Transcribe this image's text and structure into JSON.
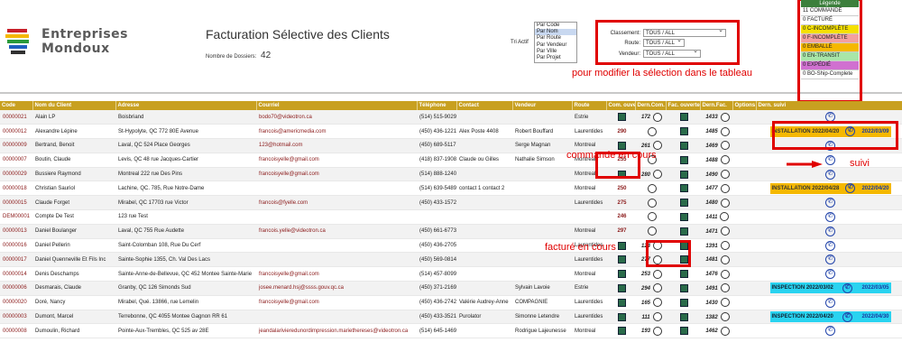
{
  "header": {
    "logo_line1": "Entreprises",
    "logo_line2": "Mondoux",
    "title": "Facturation Sélective des Clients",
    "dossier_label": "Nombre de Dossiers:",
    "dossier_count": "42",
    "tri_label": "Tri Actif",
    "tri_options": [
      "Par Code",
      "Par Nom",
      "Par Route",
      "Par Vendeur",
      "Par Ville",
      "Par Projet"
    ],
    "tri_selected_index": 1
  },
  "filters": {
    "classement_label": "Classement:",
    "classement_value": "TOUS / ALL",
    "route_label": "Route:",
    "route_value": "TOUS / ALL",
    "vendeur_label": "Vendeur:",
    "vendeur_value": "TOUS / ALL"
  },
  "annotations": {
    "modify": "pour modifier la sélection dans le tableau",
    "commande": "commande en cours",
    "facture": "facturé en cours",
    "suivi": "suivi"
  },
  "legend": {
    "title": "Légende",
    "items": [
      {
        "label": "11 COMMANDÉ",
        "color": "#ffffff"
      },
      {
        "label": "0 FACTURÉ",
        "color": "#ffffff"
      },
      {
        "label": "0 C-INCOMPLÈTE",
        "color": "#f5e000"
      },
      {
        "label": "0 F-INCOMPLÈTE",
        "color": "#f3a0a0"
      },
      {
        "label": "0 EMBALLÉ",
        "color": "#f5b800"
      },
      {
        "label": "0 EN-TRANSIT",
        "color": "#a8e6a8"
      },
      {
        "label": "0 EXPÉDIÉ",
        "color": "#d070d0"
      },
      {
        "label": "0 BO-Ship-Complete",
        "color": "#ffffff"
      }
    ]
  },
  "table": {
    "headers": [
      "Code",
      "Nom du Client",
      "Adresse",
      "Courriel",
      "Téléphone",
      "Contact",
      "Vendeur",
      "Route",
      "Com. ouverte",
      "Dern.Com.",
      "Fac. ouverte",
      "Dern.Fac.",
      "Options",
      "Dern. suivi"
    ],
    "rows": [
      {
        "code": "00000021",
        "nom": "Alain LP",
        "adresse": "Boisbriand",
        "courriel": "bodo70@videotron.ca",
        "tel": "(514) 515-9029",
        "contact": "",
        "vendeur": "",
        "route": "Estrie",
        "com_open": "",
        "dern_com": "172",
        "fac_open": "",
        "dern_fac": "1433",
        "suivi_type": "",
        "suivi_text": "",
        "suivi_date": ""
      },
      {
        "code": "00000012",
        "nom": "Alexandre Lépine",
        "adresse": "St-Hypolyte, QC 772 80E Avenue",
        "courriel": "francois@americmedia.com",
        "tel": "(450) 436-1221",
        "contact": "Alex Poste 4408",
        "vendeur": "Robert Bouffard",
        "route": "Laurentides",
        "com_open": "290",
        "dern_com": "",
        "fac_open": "",
        "dern_fac": "1485",
        "suivi_type": "install",
        "suivi_text": "INSTALLATION 2022/04/20",
        "suivi_date": "2022/03/09"
      },
      {
        "code": "00000009",
        "nom": "Bertrand, Benoit",
        "adresse": "Laval, QC 524 Place Georges",
        "courriel": "123@hotmail.com",
        "tel": "(450) 689-5117",
        "contact": "",
        "vendeur": "Serge Magnan",
        "route": "Montreal",
        "com_open": "",
        "dern_com": "261",
        "fac_open": "",
        "dern_fac": "1469",
        "suivi_type": "",
        "suivi_text": "",
        "suivi_date": ""
      },
      {
        "code": "00000007",
        "nom": "Boutin, Claude",
        "adresse": "Levis, QC 48 rue Jacques-Cartier",
        "courriel": "francoisyelle@gmail.com",
        "tel": "(418) 837-1908",
        "contact": "Claude ou Gilles",
        "vendeur": "Nathalie Simson",
        "route": "Montreal",
        "com_open": "255",
        "dern_com": "",
        "fac_open": "",
        "dern_fac": "1488",
        "suivi_type": "",
        "suivi_text": "",
        "suivi_date": ""
      },
      {
        "code": "00000029",
        "nom": "Bussiere Raymond",
        "adresse": "Montreal 222 rue Des Pins",
        "courriel": "francoisyelle@gmail.com",
        "tel": "(514) 888-1240",
        "contact": "",
        "vendeur": "",
        "route": "Montreal",
        "com_open": "",
        "dern_com": "280",
        "fac_open": "",
        "dern_fac": "1490",
        "suivi_type": "",
        "suivi_text": "",
        "suivi_date": ""
      },
      {
        "code": "00000018",
        "nom": "Christian Sauriol",
        "adresse": "Lachine, QC. 785, Rue Notre-Dame",
        "courriel": "",
        "tel": "(514) 639-5489",
        "contact": "contact 1 contact 2",
        "vendeur": "",
        "route": "Montreal",
        "com_open": "250",
        "dern_com": "",
        "fac_open": "",
        "dern_fac": "1477",
        "suivi_type": "install",
        "suivi_text": "INSTALLATION 2022/04/28",
        "suivi_date": "2022/04/20"
      },
      {
        "code": "00000015",
        "nom": "Claude Forget",
        "adresse": "Mirabel, QC 17703 rue Victor",
        "courriel": "francois@fyelle.com",
        "tel": "(450) 433-1572",
        "contact": "",
        "vendeur": "",
        "route": "Laurentides",
        "com_open": "275",
        "dern_com": "",
        "fac_open": "",
        "dern_fac": "1480",
        "suivi_type": "",
        "suivi_text": "",
        "suivi_date": ""
      },
      {
        "code": "DEM00001",
        "nom": "Compte De Test",
        "adresse": "123 rue Test",
        "courriel": "",
        "tel": "",
        "contact": "",
        "vendeur": "",
        "route": "",
        "com_open": "246",
        "dern_com": "",
        "fac_open": "",
        "dern_fac": "1411",
        "suivi_type": "",
        "suivi_text": "",
        "suivi_date": ""
      },
      {
        "code": "00000013",
        "nom": "Daniel Boulanger",
        "adresse": "Laval, QC 755 Rue Audette",
        "courriel": "francois.yelle@videotron.ca",
        "tel": "(450) 661-6773",
        "contact": "",
        "vendeur": "",
        "route": "Montreal",
        "com_open": "297",
        "dern_com": "",
        "fac_open": "",
        "dern_fac": "1471",
        "suivi_type": "",
        "suivi_text": "",
        "suivi_date": ""
      },
      {
        "code": "00000016",
        "nom": "Daniel Pellerin",
        "adresse": "Saint-Colomban 108, Rue Du Cerf",
        "courriel": "",
        "tel": "(450) 436-2705",
        "contact": "",
        "vendeur": "",
        "route": "Laurentides",
        "com_open": "",
        "dern_com": "124",
        "fac_open": "",
        "dern_fac": "1391",
        "suivi_type": "",
        "suivi_text": "",
        "suivi_date": ""
      },
      {
        "code": "00000017",
        "nom": "Daniel Quenneville Et Fils Inc",
        "adresse": "Sainte-Sophie 1355, Ch. Val Des Lacs",
        "courriel": "",
        "tel": "(450) 569-0814",
        "contact": "",
        "vendeur": "",
        "route": "Laurentides",
        "com_open": "",
        "dern_com": "277",
        "fac_open": "",
        "dern_fac": "1481",
        "suivi_type": "",
        "suivi_text": "",
        "suivi_date": ""
      },
      {
        "code": "00000014",
        "nom": "Denis Deschamps",
        "adresse": "Sainte-Anne-de-Bellevue, QC 452 Montee Sainte-Marie",
        "courriel": "francoisyelle@gmail.com",
        "tel": "(514) 457-8099",
        "contact": "",
        "vendeur": "",
        "route": "Montreal",
        "com_open": "",
        "dern_com": "253",
        "fac_open": "",
        "dern_fac": "1476",
        "suivi_type": "",
        "suivi_text": "",
        "suivi_date": ""
      },
      {
        "code": "00000006",
        "nom": "Desmarais, Claude",
        "adresse": "Granby, QC 126 Simonds Sud",
        "courriel": "josee.menard.hsj@ssss.gouv.qc.ca",
        "tel": "(450) 371-2169",
        "contact": "",
        "vendeur": "Sylvain Lavoie",
        "route": "Estrie",
        "com_open": "",
        "dern_com": "294",
        "fac_open": "",
        "dern_fac": "1491",
        "suivi_type": "inspect",
        "suivi_text": "INSPECTION 2022/03/02",
        "suivi_date": "2022/03/05"
      },
      {
        "code": "00000020",
        "nom": "Doré, Nancy",
        "adresse": "Mirabel, Qué. 13866, rue Lemelin",
        "courriel": "francoisyelle@gmail.com",
        "tel": "(450) 436-2742",
        "contact": "Valérie Audrey-Anne",
        "vendeur": "COMPAGNIE",
        "route": "Laurentides",
        "com_open": "",
        "dern_com": "165",
        "fac_open": "",
        "dern_fac": "1430",
        "suivi_type": "",
        "suivi_text": "",
        "suivi_date": ""
      },
      {
        "code": "00000003",
        "nom": "Dumont, Marcel",
        "adresse": "Terrebonne, QC 4055 Montee Gagnon RR 61",
        "courriel": "",
        "tel": "(450) 433-3521",
        "contact": "Purolator",
        "vendeur": "Simonne Letendre",
        "route": "Laurentides",
        "com_open": "",
        "dern_com": "111",
        "fac_open": "",
        "dern_fac": "1382",
        "suivi_type": "inspect",
        "suivi_text": "INSPECTION 2022/04/20",
        "suivi_date": "2022/04/30"
      },
      {
        "code": "00000008",
        "nom": "Dumoulin, Richard",
        "adresse": "Pointe-Aux-Trembles, QC 525 av 28E",
        "courriel": "jeandalarivieredunordimpression.mariethereses@videotron.ca",
        "tel": "(514) 645-1469",
        "contact": "",
        "vendeur": "Rodrigue Lajeunesse",
        "route": "Montreal",
        "com_open": "",
        "dern_com": "193",
        "fac_open": "",
        "dern_fac": "1462",
        "suivi_type": "",
        "suivi_text": "",
        "suivi_date": ""
      }
    ]
  }
}
